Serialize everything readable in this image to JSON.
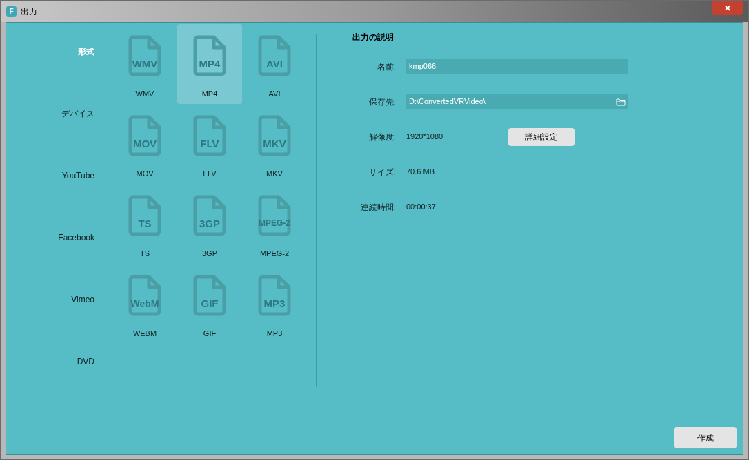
{
  "window": {
    "title": "出力",
    "app_icon_letter": "F",
    "close_label": "✕"
  },
  "categories": [
    {
      "label": "形式",
      "selected": true
    },
    {
      "label": "デバイス",
      "selected": false
    },
    {
      "label": "YouTube",
      "selected": false
    },
    {
      "label": "Facebook",
      "selected": false
    },
    {
      "label": "Vimeo",
      "selected": false
    },
    {
      "label": "DVD",
      "selected": false
    }
  ],
  "formats": [
    {
      "icon_text": "WMV",
      "label": "WMV",
      "selected": false
    },
    {
      "icon_text": "MP4",
      "label": "MP4",
      "selected": true
    },
    {
      "icon_text": "AVI",
      "label": "AVI",
      "selected": false
    },
    {
      "icon_text": "MOV",
      "label": "MOV",
      "selected": false
    },
    {
      "icon_text": "FLV",
      "label": "FLV",
      "selected": false
    },
    {
      "icon_text": "MKV",
      "label": "MKV",
      "selected": false
    },
    {
      "icon_text": "TS",
      "label": "TS",
      "selected": false
    },
    {
      "icon_text": "3GP",
      "label": "3GP",
      "selected": false
    },
    {
      "icon_text": "MPEG-2",
      "label": "MPEG-2",
      "selected": false
    },
    {
      "icon_text": "WebM",
      "label": "WEBM",
      "selected": false
    },
    {
      "icon_text": "GIF",
      "label": "GIF",
      "selected": false
    },
    {
      "icon_text": "MP3",
      "label": "MP3",
      "selected": false
    }
  ],
  "description": {
    "title": "出力の説明",
    "rows": [
      {
        "kind": "field",
        "label": "名前:",
        "value": "kmp066"
      },
      {
        "kind": "folder",
        "label": "保存先:",
        "value": "D:\\ConvertedVRVideo\\"
      },
      {
        "kind": "button",
        "label": "解像度:",
        "value": "1920*1080",
        "button": "詳細設定"
      },
      {
        "kind": "text",
        "label": "サイズ:",
        "value": "70.6 MB"
      },
      {
        "kind": "text",
        "label": "連続時間:",
        "value": "00:00:37"
      }
    ]
  },
  "create_button": "作成"
}
